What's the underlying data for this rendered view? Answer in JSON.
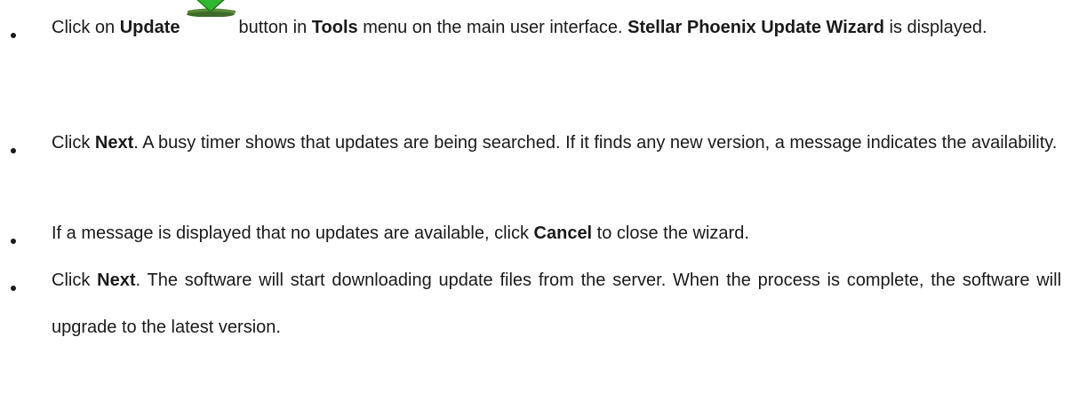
{
  "steps": [
    {
      "t1": "Click on ",
      "b1": "Update",
      "t2": "button in ",
      "b2": "Tools",
      "t3": " menu on the main user interface. ",
      "b3": "Stellar Phoenix Update Wizard",
      "t4": " is displayed.",
      "icon": "update-download-arrow-icon"
    },
    {
      "t1": "Click ",
      "b1": "Next",
      "t2": ". A busy timer shows that updates are being searched. If it finds any new version, a message indicates the availability."
    },
    {
      "t1": "If a message is displayed that no updates are available, click ",
      "b1": "Cancel",
      "t2": " to close the wizard."
    },
    {
      "t1": "Click ",
      "b1": "Next",
      "t2": ". The software will start downloading update files from the server. When the process is complete, the software will upgrade to the latest version."
    }
  ],
  "colors": {
    "text": "#1a1a1a",
    "arrow_green": "#2fb82f",
    "arrow_dark_green": "#1e7a1e",
    "tray_green": "#5a8a3a"
  }
}
